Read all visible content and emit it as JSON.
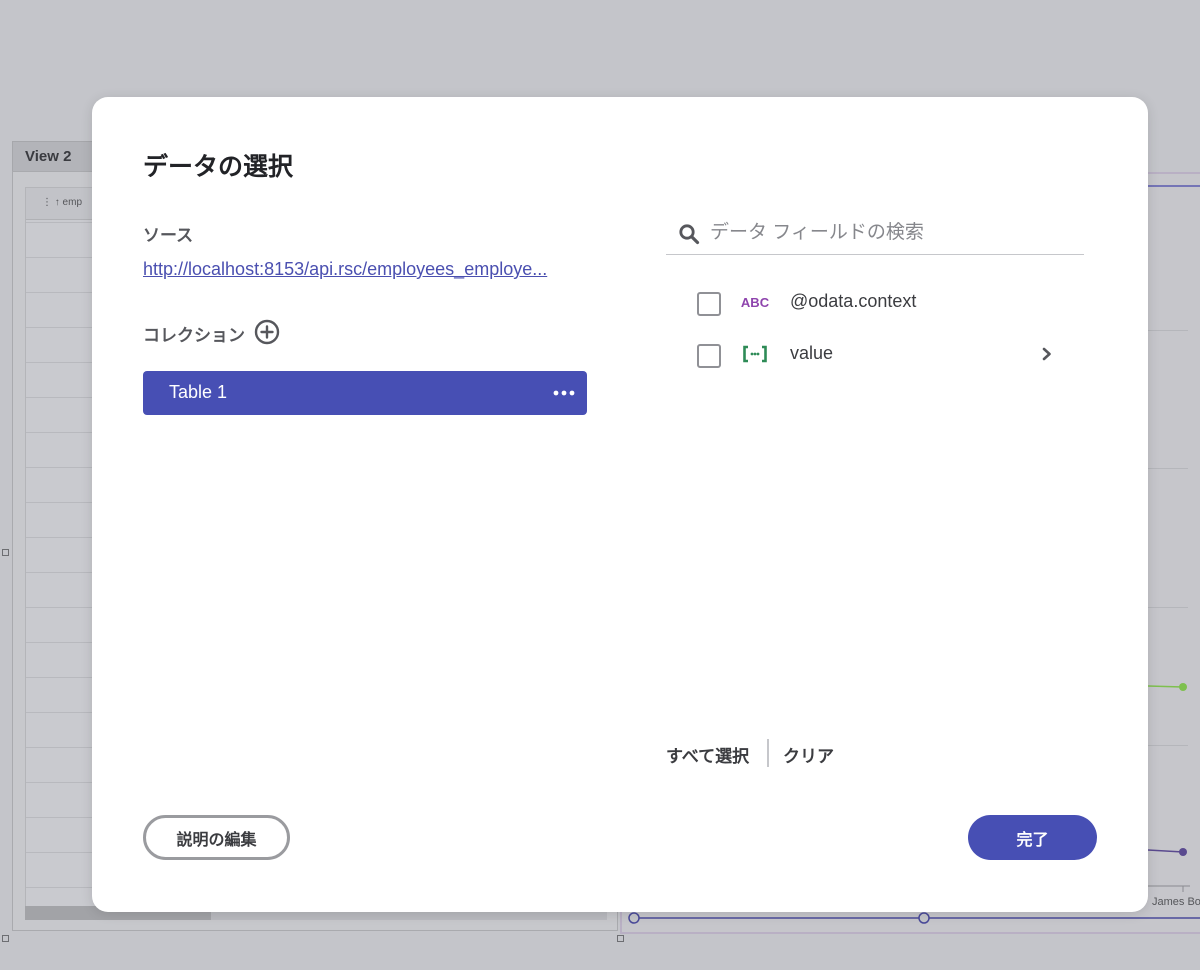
{
  "background": {
    "view_tab_label": "View 2",
    "grid_header_text": "⋮ ↑  emp",
    "chart_footer_label": "James Bo"
  },
  "modal": {
    "title": "データの選択",
    "source_label": "ソース",
    "source_url": "http://localhost:8153/api.rsc/employees_employe...",
    "collection_label": "コレクション",
    "collections": [
      {
        "label": "Table 1"
      }
    ],
    "search": {
      "placeholder": "データ フィールドの検索",
      "value": ""
    },
    "fields": [
      {
        "name": "@odata.context",
        "type_icon": "abc-text-type-icon",
        "type_label": "ABC",
        "checked": false,
        "expandable": false
      },
      {
        "name": "value",
        "type_icon": "array-type-icon",
        "type_label": "[··]",
        "checked": false,
        "expandable": true
      }
    ],
    "select_all_label": "すべて選択",
    "clear_label": "クリア",
    "edit_description_label": "説明の編集",
    "done_label": "完了"
  },
  "colors": {
    "primary": "#474fb4",
    "text_type_icon": "#8e44ad",
    "array_type_icon": "#2e8b57",
    "overlay_bg": "#c4c5ca"
  }
}
